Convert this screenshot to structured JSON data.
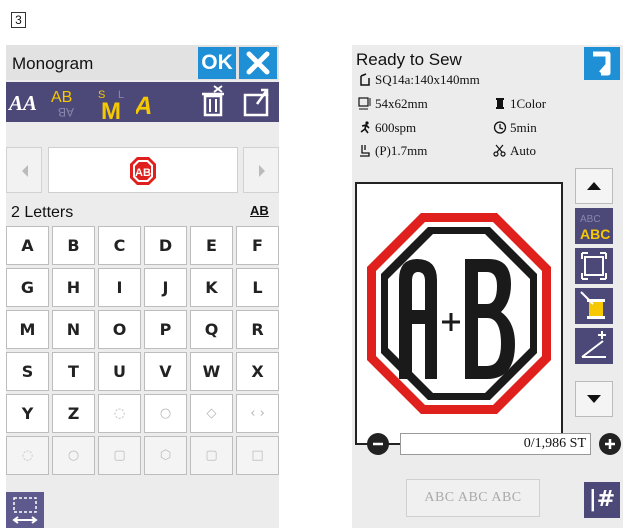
{
  "step_number": "3",
  "monogram": {
    "title": "Monogram",
    "ok_label": "OK",
    "letters_count": "2 Letters",
    "case_label": "AB",
    "preview_text": "AB",
    "keys": [
      {
        "label": "A",
        "kind": "letter"
      },
      {
        "label": "B",
        "kind": "letter"
      },
      {
        "label": "C",
        "kind": "letter"
      },
      {
        "label": "D",
        "kind": "letter"
      },
      {
        "label": "E",
        "kind": "letter"
      },
      {
        "label": "F",
        "kind": "letter"
      },
      {
        "label": "G",
        "kind": "letter"
      },
      {
        "label": "H",
        "kind": "letter"
      },
      {
        "label": "I",
        "kind": "letter"
      },
      {
        "label": "J",
        "kind": "letter"
      },
      {
        "label": "K",
        "kind": "letter"
      },
      {
        "label": "L",
        "kind": "letter"
      },
      {
        "label": "M",
        "kind": "letter"
      },
      {
        "label": "N",
        "kind": "letter"
      },
      {
        "label": "O",
        "kind": "letter"
      },
      {
        "label": "P",
        "kind": "letter"
      },
      {
        "label": "Q",
        "kind": "letter"
      },
      {
        "label": "R",
        "kind": "letter"
      },
      {
        "label": "S",
        "kind": "letter"
      },
      {
        "label": "T",
        "kind": "letter"
      },
      {
        "label": "U",
        "kind": "letter"
      },
      {
        "label": "V",
        "kind": "letter"
      },
      {
        "label": "W",
        "kind": "letter"
      },
      {
        "label": "X",
        "kind": "letter"
      },
      {
        "label": "Y",
        "kind": "letter"
      },
      {
        "label": "Z",
        "kind": "letter"
      },
      {
        "label": "◌",
        "kind": "dim"
      },
      {
        "label": "○",
        "kind": "dim"
      },
      {
        "label": "◇",
        "kind": "dim"
      },
      {
        "label": "‹ ›",
        "kind": "dim"
      },
      {
        "label": "◌",
        "kind": "empty"
      },
      {
        "label": "○",
        "kind": "empty"
      },
      {
        "label": "▢",
        "kind": "empty"
      },
      {
        "label": "⬡",
        "kind": "empty"
      },
      {
        "label": "▢",
        "kind": "empty"
      },
      {
        "label": "□",
        "kind": "empty"
      }
    ]
  },
  "ready": {
    "title": "Ready to Sew",
    "hoop": "SQ14a:140x140mm",
    "size": "54x62mm",
    "colors": "1Color",
    "speed": "600spm",
    "time": "5min",
    "presser": "(P)1.7mm",
    "thread_cut": "Auto",
    "design_text": "A+B",
    "stitch_count": "0/1,986 ST",
    "abc_label": "ABC ABC ABC",
    "sharp_label": "|#"
  },
  "colors": {
    "blue_button": "#1f8fd6",
    "toolbar": "#4c4878",
    "stitch_red": "#e0201c",
    "stitch_black": "#1a1a1a"
  }
}
